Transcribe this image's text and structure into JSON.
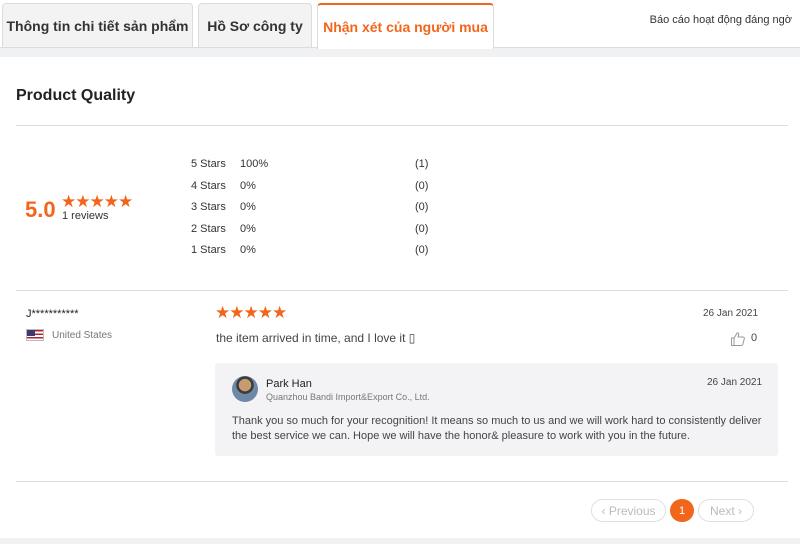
{
  "tabs": {
    "product_details": "Thông tin chi tiết sản phẩm",
    "company_profile": "Hồ Sơ công ty",
    "buyer_reviews": "Nhận xét của người mua",
    "report_link": "Báo cáo hoạt động đáng ngờ"
  },
  "section": {
    "title": "Product Quality"
  },
  "summary": {
    "average": "5.0",
    "stars": "★★★★★",
    "review_count": "1 reviews",
    "distribution": [
      {
        "label": "5 Stars",
        "percent": "100%",
        "count": "(1)"
      },
      {
        "label": "4 Stars",
        "percent": "0%",
        "count": "(0)"
      },
      {
        "label": "3 Stars",
        "percent": "0%",
        "count": "(0)"
      },
      {
        "label": "2 Stars",
        "percent": "0%",
        "count": "(0)"
      },
      {
        "label": "1 Stars",
        "percent": "0%",
        "count": "(0)"
      }
    ]
  },
  "review": {
    "reviewer": "J***********",
    "country": "United States",
    "flag_icon": "us-flag-icon",
    "stars": "★★★★★",
    "rating": 5,
    "date": "26 Jan 2021",
    "text": "the item arrived in time, and I love it ▯",
    "like_icon": "thumbs-up-icon",
    "likes": "0",
    "reply": {
      "name": "Park Han",
      "company": "Quanzhou Bandi Import&Export Co., Ltd.",
      "date": "26 Jan 2021",
      "text": "Thank you so much for your recognition! It means so much to us and we will work hard to consistently deliver the best service we can. Hope we will have the honor& pleasure to work with you in the future."
    }
  },
  "pagination": {
    "previous": "Previous",
    "current": "1",
    "next": "Next"
  },
  "colors": {
    "accent": "#f2661c",
    "divider": "#dcdcdc",
    "reply_bg": "#f3f3f5"
  }
}
